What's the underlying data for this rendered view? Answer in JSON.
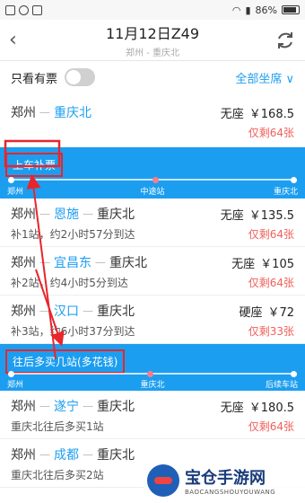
{
  "status_bar": {
    "battery": "86%"
  },
  "header": {
    "title": "11月12日Z49",
    "route": "郑州 - 重庆北"
  },
  "filter": {
    "only_available_label": "只看有票",
    "seat_filter_label": "全部坐席 ∨"
  },
  "direct": {
    "from": "郑州",
    "to": "重庆北",
    "seat": "无座",
    "price": "￥168.5",
    "remain": "仅剩64张"
  },
  "section1": {
    "heading": "上车补票",
    "labels": [
      "郑州",
      "中途站",
      "重庆北"
    ]
  },
  "list1": [
    {
      "from": "郑州",
      "via": "恩施",
      "to": "重庆北",
      "seat": "无座",
      "price": "￥135.5",
      "info": "补1站，约2小时57分到达",
      "remain": "仅剩64张"
    },
    {
      "from": "郑州",
      "via": "宜昌东",
      "to": "重庆北",
      "seat": "无座",
      "price": "￥105",
      "info": "补2站，约4小时5分到达",
      "remain": "仅剩64张"
    },
    {
      "from": "郑州",
      "via": "汉口",
      "to": "重庆北",
      "seat": "硬座",
      "price": "￥72",
      "info": "补3站，约6小时37分到达",
      "remain": "仅剩33张"
    }
  ],
  "section2": {
    "heading": "往后多买几站(多花钱)",
    "labels": [
      "郑州",
      "重庆北",
      "后续车站"
    ]
  },
  "list2": [
    {
      "from": "郑州",
      "via": "遂宁",
      "to": "重庆北",
      "seat": "无座",
      "price": "￥180.5",
      "info": "重庆北往后多买1站",
      "remain": "仅剩64张"
    },
    {
      "from": "郑州",
      "via": "成都",
      "to": "重庆北",
      "seat": "",
      "price": "",
      "info": "重庆北往后多买2站",
      "remain": ""
    }
  ],
  "watermark": {
    "main": "宝仓手游网",
    "sub": "BAOCANGSHOUYOUWANG"
  },
  "colors": {
    "accent": "#1c9ef0",
    "warning": "#f0605a",
    "annotation": "#e6262c"
  }
}
